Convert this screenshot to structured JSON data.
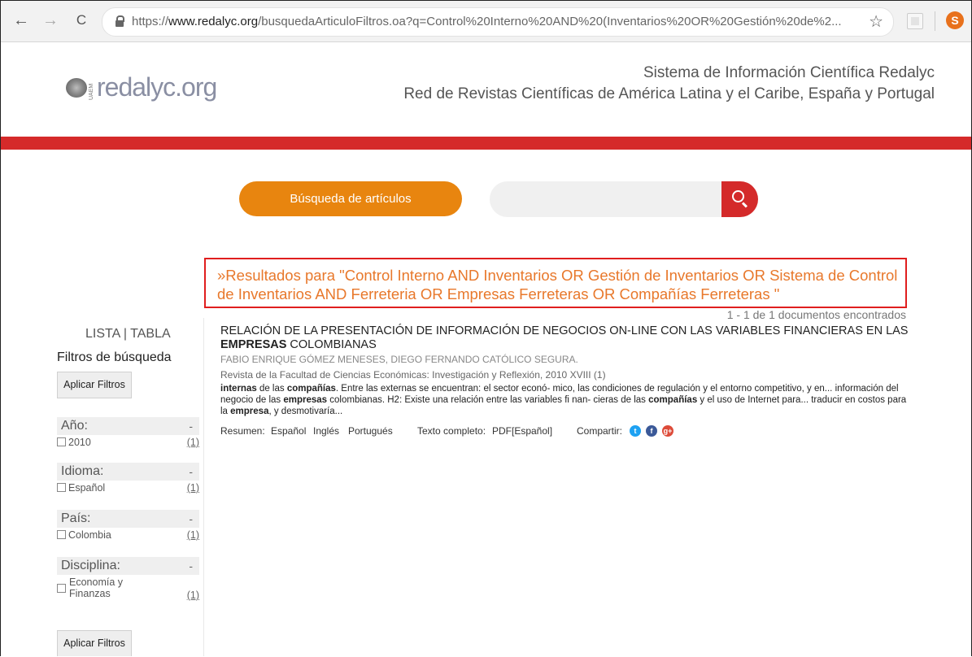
{
  "browser": {
    "url_scheme": "https://",
    "url_host": "www.redalyc.org",
    "url_path": "/busquedaArticuloFiltros.oa?q=Control%20Interno%20AND%20(Inventarios%20OR%20Gestión%20de%2...",
    "avatar_letter": "S",
    "back_glyph": "←",
    "forward_glyph": "→",
    "reload_glyph": "C",
    "star_glyph": "☆"
  },
  "site": {
    "logo_text": "redalyc.org",
    "logo_side_text": "UAEM",
    "header_line1": "Sistema de Información Científica Redalyc",
    "header_line2": "Red de Revistas Científicas de América Latina y el Caribe, España y Portugal",
    "accent_red": "#d52a2a",
    "accent_orange": "#e8850f"
  },
  "search": {
    "tab_label": "Búsqueda de artículos",
    "input_value": "",
    "input_placeholder": ""
  },
  "results": {
    "heading": "»Resultados para \"Control Interno AND Inventarios OR Gestión de Inventarios OR Sistema de Control de Inventarios AND Ferreteria OR Empresas Ferreteras OR Compañías Ferreteras \"",
    "count_text": "1 - 1 de 1 documentos encontrados"
  },
  "sidebar": {
    "view_list": "LISTA",
    "view_sep": " | ",
    "view_table": "TABLA",
    "filters_title": "Filtros de búsqueda",
    "apply_label": "Aplicar Filtros",
    "collapse_glyph": "-",
    "facets": [
      {
        "title": "Año:",
        "option": "2010",
        "count": "(1)"
      },
      {
        "title": "Idioma:",
        "option": "Español",
        "count": "(1)"
      },
      {
        "title": "País:",
        "option": "Colombia",
        "count": "(1)"
      },
      {
        "title": "Disciplina:",
        "option": "Economía y Finanzas",
        "count": "(1)"
      }
    ]
  },
  "article": {
    "title_part1": "RELACIÓN DE LA PRESENTACIÓN DE INFORMACIÓN DE NEGOCIOS ON-LINE CON LAS VARIABLES FINANCIERAS EN LAS ",
    "title_bold": "EMPRESAS",
    "title_part2": " COLOMBIANAS",
    "authors": "FABIO ENRIQUE GÓMEZ MENESES, DIEGO FERNANDO CATÓLICO SEGURA.",
    "journal": "Revista de la Facultad de Ciencias Económicas: Investigación y Reflexión,  2010 XVIII (1)",
    "snippet": [
      {
        "t": "internas",
        "b": true
      },
      {
        "t": " de las ",
        "b": false
      },
      {
        "t": "compañías",
        "b": true
      },
      {
        "t": ". Entre las externas se encuentran: el sector econó- mico, las condiciones de regulación y el entorno competitivo, y en... información del negocio de las ",
        "b": false
      },
      {
        "t": "empresas",
        "b": true
      },
      {
        "t": " colombianas. H2: Existe una relación entre las variables fi nan- cieras de las ",
        "b": false
      },
      {
        "t": "compañías",
        "b": true
      },
      {
        "t": " y el uso de Internet para... traducir en costos para la ",
        "b": false
      },
      {
        "t": "empresa",
        "b": true
      },
      {
        "t": ", y desmotivaría...",
        "b": false
      }
    ],
    "resumen_label": "Resumen:",
    "lang_es": "Español",
    "lang_en": "Inglés",
    "lang_pt": "Portugués",
    "fulltext_label": "Texto completo:",
    "fulltext_link": "PDF[Español]",
    "share_label": "Compartir:",
    "share_twitter": "t",
    "share_facebook": "f",
    "share_google": "g+",
    "twitter_color": "#1da1f2",
    "facebook_color": "#3b5998",
    "google_color": "#dd4b39"
  }
}
